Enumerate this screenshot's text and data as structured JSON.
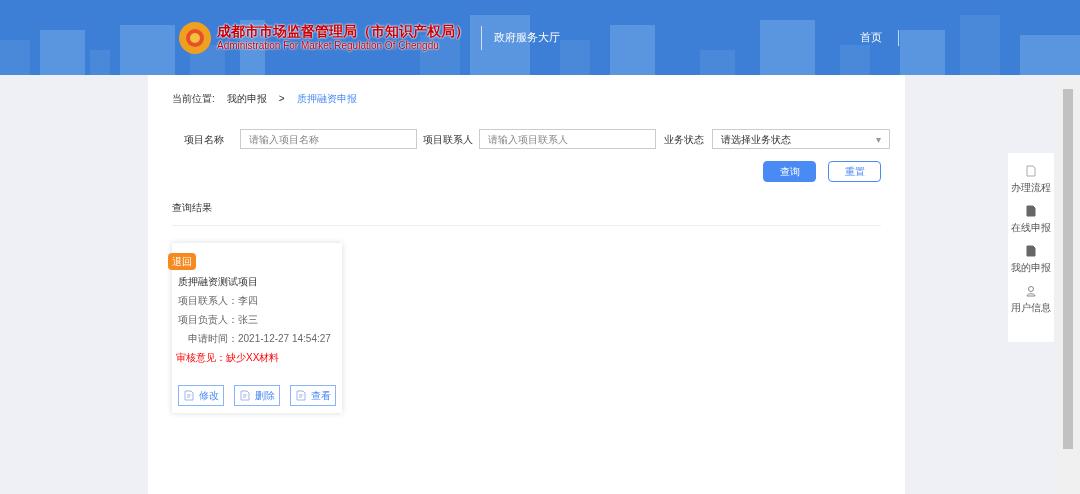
{
  "header": {
    "title": "成都市市场监督管理局（市知识产权局）",
    "subtitle": "Administration For Market Regulation Of Chengdu",
    "portal": "政府服务大厅",
    "nav": [
      "首页"
    ]
  },
  "breadcrumb": {
    "label": "当前位置:",
    "items": [
      {
        "text": "我的申报",
        "current": false
      },
      {
        "text": "质押融资申报",
        "current": true
      }
    ],
    "separator": ">"
  },
  "filters": [
    {
      "label": "项目名称",
      "kind": "input",
      "placeholder": "请输入项目名称"
    },
    {
      "label": "项目联系人",
      "kind": "input",
      "placeholder": "请输入项目联系人"
    },
    {
      "label": "业务状态",
      "kind": "select",
      "value": "请选择业务状态",
      "caret": "▾"
    }
  ],
  "buttons": [
    {
      "text": "查询",
      "primary": true
    },
    {
      "text": "重置",
      "primary": false
    }
  ],
  "results_title": "查询结果",
  "cards": [
    {
      "badge": "退回",
      "title": "质押融资测试项目",
      "fields": [
        "项目联系人：李四",
        "项目负责人：张三",
        "申请时间：2021-12-27 14:54:27"
      ],
      "remark": "审核意见：缺少XX材料",
      "actions": [
        "修改",
        "删除",
        "查看"
      ]
    }
  ],
  "side_menu": [
    "办理流程",
    "在线申报",
    "我的申报",
    "用户信息"
  ]
}
